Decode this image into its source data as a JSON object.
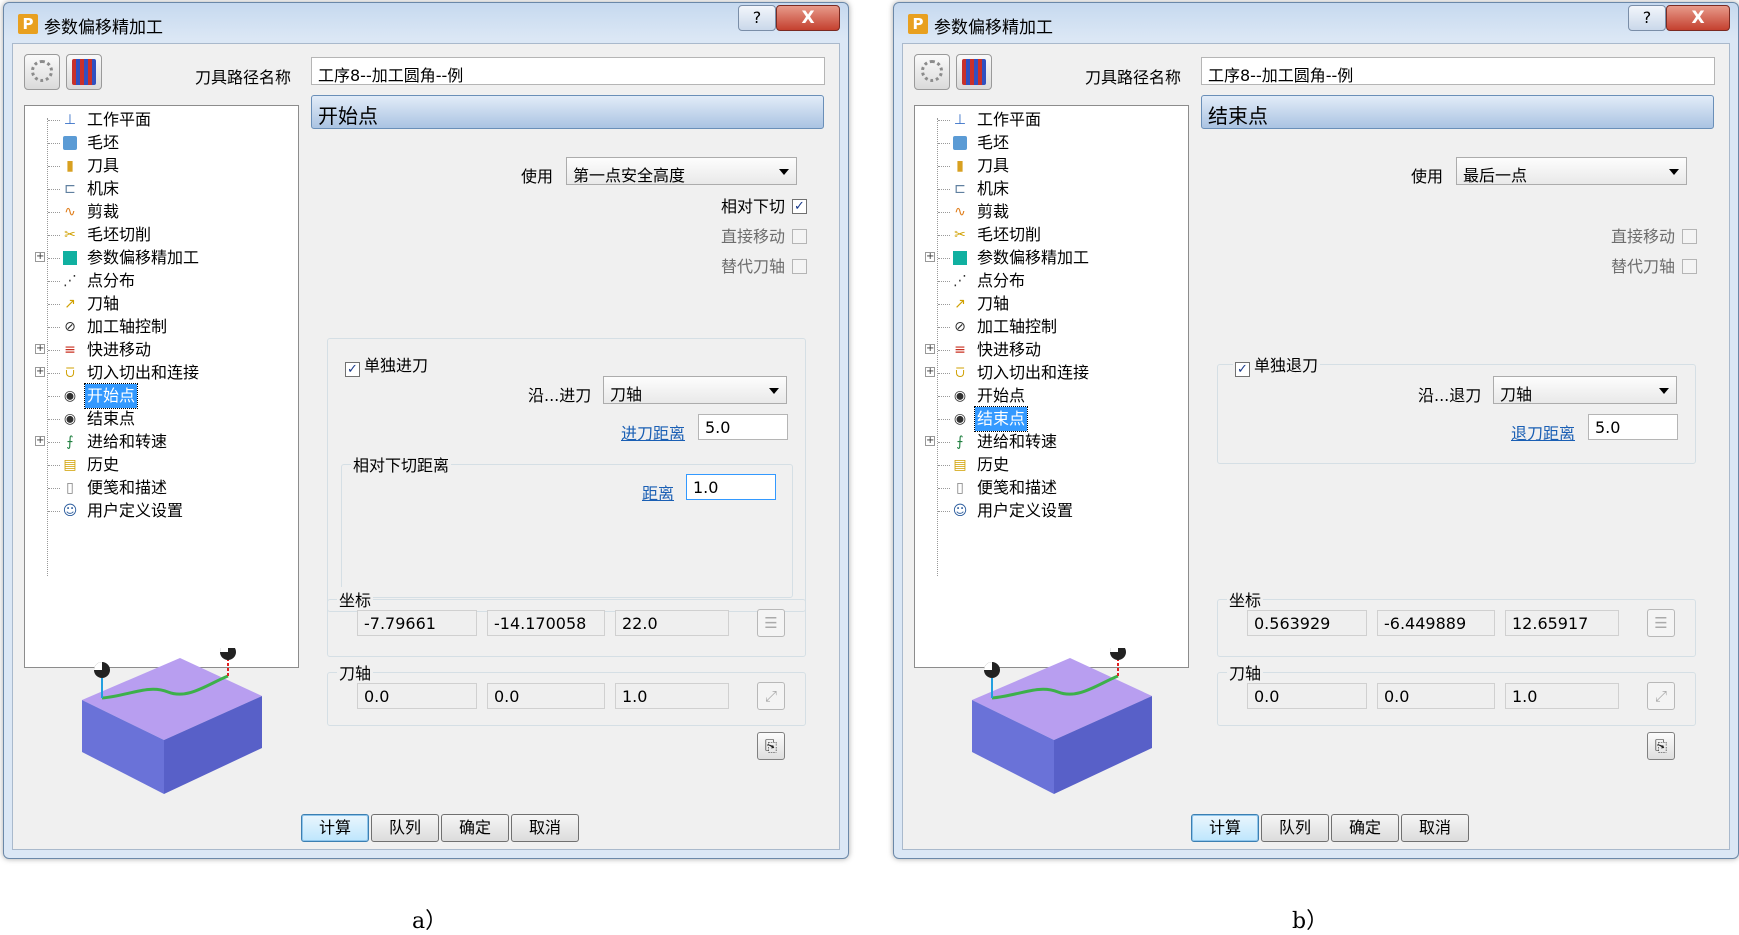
{
  "dialog_title": "参数偏移精加工",
  "path_name_label": "刀具路径名称",
  "path_name_value": "工序8--加工圆角--例",
  "tree_items": [
    {
      "label": "工作平面",
      "icon": "workplane-icon",
      "expand": false
    },
    {
      "label": "毛坯",
      "icon": "block-icon",
      "expand": false
    },
    {
      "label": "刀具",
      "icon": "tool-icon",
      "expand": false
    },
    {
      "label": "机床",
      "icon": "machine-icon",
      "expand": false
    },
    {
      "label": "剪裁",
      "icon": "limit-icon",
      "expand": false
    },
    {
      "label": "毛坯切削",
      "icon": "stock-cut-icon",
      "expand": false
    },
    {
      "label": "参数偏移精加工",
      "icon": "strategy-icon",
      "expand": true
    },
    {
      "label": "点分布",
      "icon": "point-distribution-icon",
      "expand": false
    },
    {
      "label": "刀轴",
      "icon": "tool-axis-icon",
      "expand": false
    },
    {
      "label": "加工轴控制",
      "icon": "axis-control-icon",
      "expand": false
    },
    {
      "label": "快进移动",
      "icon": "rapid-move-icon",
      "expand": true
    },
    {
      "label": "切入切出和连接",
      "icon": "leads-links-icon",
      "expand": true
    },
    {
      "label": "开始点",
      "icon": "start-point-icon",
      "expand": false
    },
    {
      "label": "结束点",
      "icon": "end-point-icon",
      "expand": false
    },
    {
      "label": "进给和转速",
      "icon": "feeds-speeds-icon",
      "expand": true
    },
    {
      "label": "历史",
      "icon": "history-icon",
      "expand": false
    },
    {
      "label": "便笺和描述",
      "icon": "notes-icon",
      "expand": false
    },
    {
      "label": "用户定义设置",
      "icon": "user-settings-icon",
      "expand": false
    }
  ],
  "buttons": {
    "calculate": "计算",
    "queue": "队列",
    "ok": "确定",
    "cancel": "取消"
  },
  "help_glyph": "?",
  "close_glyph": "X",
  "panel_a": {
    "selected_index": 12,
    "section_title": "开始点",
    "use_label": "使用",
    "use_value": "第一点安全高度",
    "checks": [
      {
        "label": "相对下切",
        "checked": true,
        "disabled": false
      },
      {
        "label": "直接移动",
        "checked": false,
        "disabled": true
      },
      {
        "label": "替代刀轴",
        "checked": false,
        "disabled": true
      }
    ],
    "move_group_label": "单独进刀",
    "along_label": "沿...进刀",
    "along_value": "刀轴",
    "distance_label": "进刀距离",
    "distance_value": "5.0",
    "rel_group_label": "相对下切距离",
    "rel_dist_label": "距离",
    "rel_dist_value": "1.0",
    "coord_label": "坐标",
    "coords": [
      "-7.79661",
      "-14.170058",
      "22.0"
    ],
    "axis_label": "刀轴",
    "axis": [
      "0.0",
      "0.0",
      "1.0"
    ],
    "caption": "a）"
  },
  "panel_b": {
    "selected_index": 13,
    "section_title": "结束点",
    "use_label": "使用",
    "use_value": "最后一点",
    "checks": [
      {
        "label": "直接移动",
        "checked": false,
        "disabled": true
      },
      {
        "label": "替代刀轴",
        "checked": false,
        "disabled": true
      }
    ],
    "move_group_label": "单独退刀",
    "along_label": "沿...退刀",
    "along_value": "刀轴",
    "distance_label": "退刀距离",
    "distance_value": "5.0",
    "coord_label": "坐标",
    "coords": [
      "0.563929",
      "-6.449889",
      "12.65917"
    ],
    "axis_label": "刀轴",
    "axis": [
      "0.0",
      "0.0",
      "1.0"
    ],
    "caption": "b）"
  },
  "colors": {
    "selection": "#3399ff",
    "header": "#aac3e2",
    "block_top": "#b89ef0",
    "block_side": "#6a72d8",
    "toolpath": "#3cb04a"
  }
}
